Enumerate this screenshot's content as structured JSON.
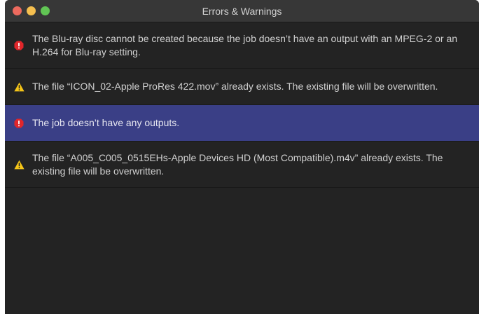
{
  "window": {
    "title": "Errors & Warnings",
    "traffic_lights": {
      "close_color": "#ed6a5e",
      "minimize_color": "#f5bf4f",
      "zoom_color": "#61c554"
    }
  },
  "colors": {
    "error": "#e0262a",
    "warning": "#f5c518",
    "selection": "#3a3f86"
  },
  "messages": [
    {
      "type": "error",
      "icon": "error-icon",
      "text": "The Blu-ray disc cannot be created because the job doesn’t have an output with an MPEG-2 or an H.264 for Blu-ray setting.",
      "selected": false
    },
    {
      "type": "warning",
      "icon": "warning-icon",
      "text": "The file “ICON_02-Apple ProRes 422.mov” already exists. The existing file will be overwritten.",
      "selected": false
    },
    {
      "type": "error",
      "icon": "error-icon",
      "text": "The job doesn’t have any outputs.",
      "selected": true
    },
    {
      "type": "warning",
      "icon": "warning-icon",
      "text": "The file “A005_C005_0515EHs-Apple Devices HD (Most Compatible).m4v” already exists. The existing file will be overwritten.",
      "selected": false
    }
  ]
}
